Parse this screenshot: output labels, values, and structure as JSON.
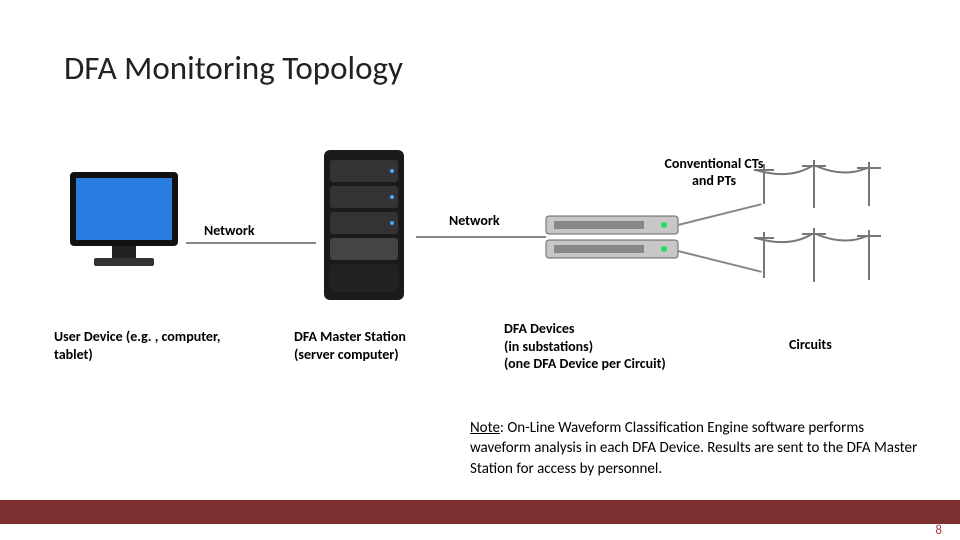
{
  "title": "DFA Monitoring Topology",
  "cts_label": "Conventional CTs and PTs",
  "links": {
    "net1": "Network",
    "net2": "Network"
  },
  "nodes": {
    "user_device": "User Device (e.g. , computer, tablet)",
    "master_station": "DFA Master Station (server computer)",
    "dfa_devices": "DFA Devices\n(in substations)\n(one DFA Device per Circuit)",
    "circuits": "Circuits"
  },
  "note_label": "Note",
  "note_text": ": On-Line Waveform Classification Engine software performs waveform analysis in each DFA Device. Results are sent to the DFA Master Station for access by personnel.",
  "page_number": "8"
}
